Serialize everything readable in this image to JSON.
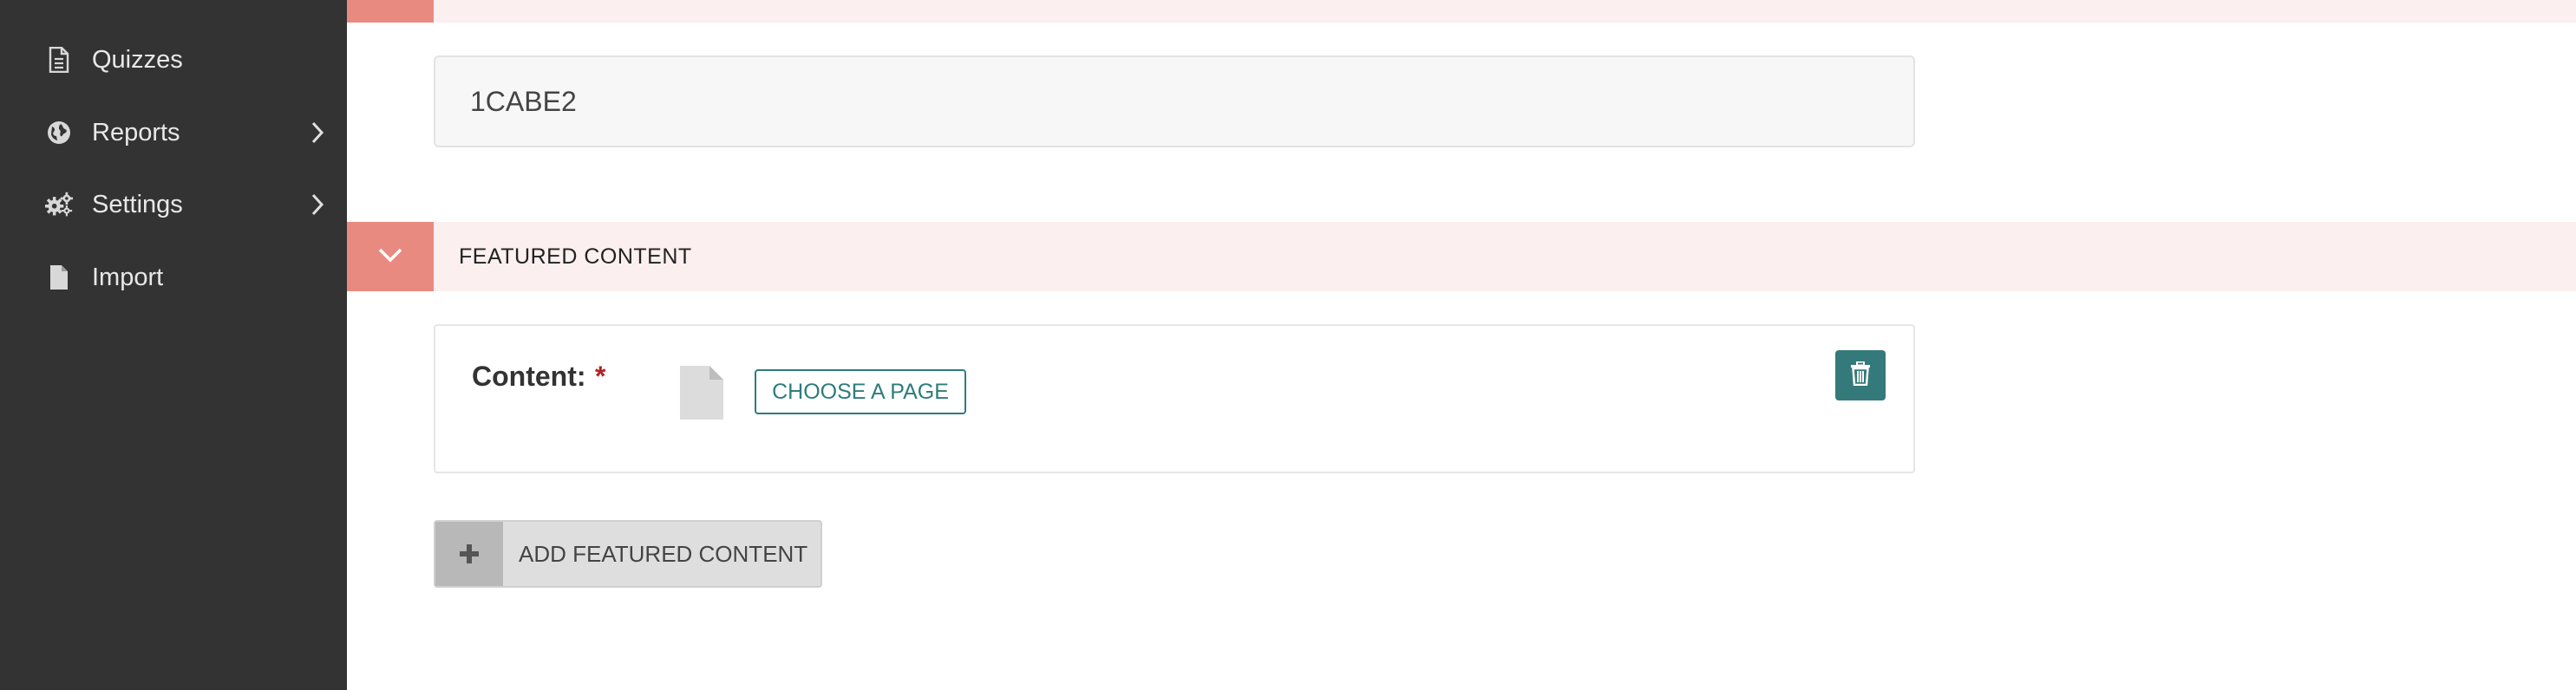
{
  "sidebar": {
    "items": [
      {
        "label": "Quizzes",
        "icon": "document-icon",
        "has_submenu": false
      },
      {
        "label": "Reports",
        "icon": "globe-icon",
        "has_submenu": true
      },
      {
        "label": "Settings",
        "icon": "gears-icon",
        "has_submenu": true
      },
      {
        "label": "Import",
        "icon": "file-icon",
        "has_submenu": false
      }
    ]
  },
  "main": {
    "code_field_value": "1CABE2",
    "featured_section": {
      "title": "FEATURED CONTENT",
      "content_label": "Content:",
      "required_marker": "*",
      "choose_button_label": "CHOOSE A PAGE",
      "add_button_label": "ADD FEATURED CONTENT",
      "add_button_icon": "+"
    }
  },
  "colors": {
    "sidebar_bg": "#333333",
    "section_band": "#fbefef",
    "section_toggle": "#e98a80",
    "teal": "#2f7c7c",
    "required": "#b22222"
  }
}
